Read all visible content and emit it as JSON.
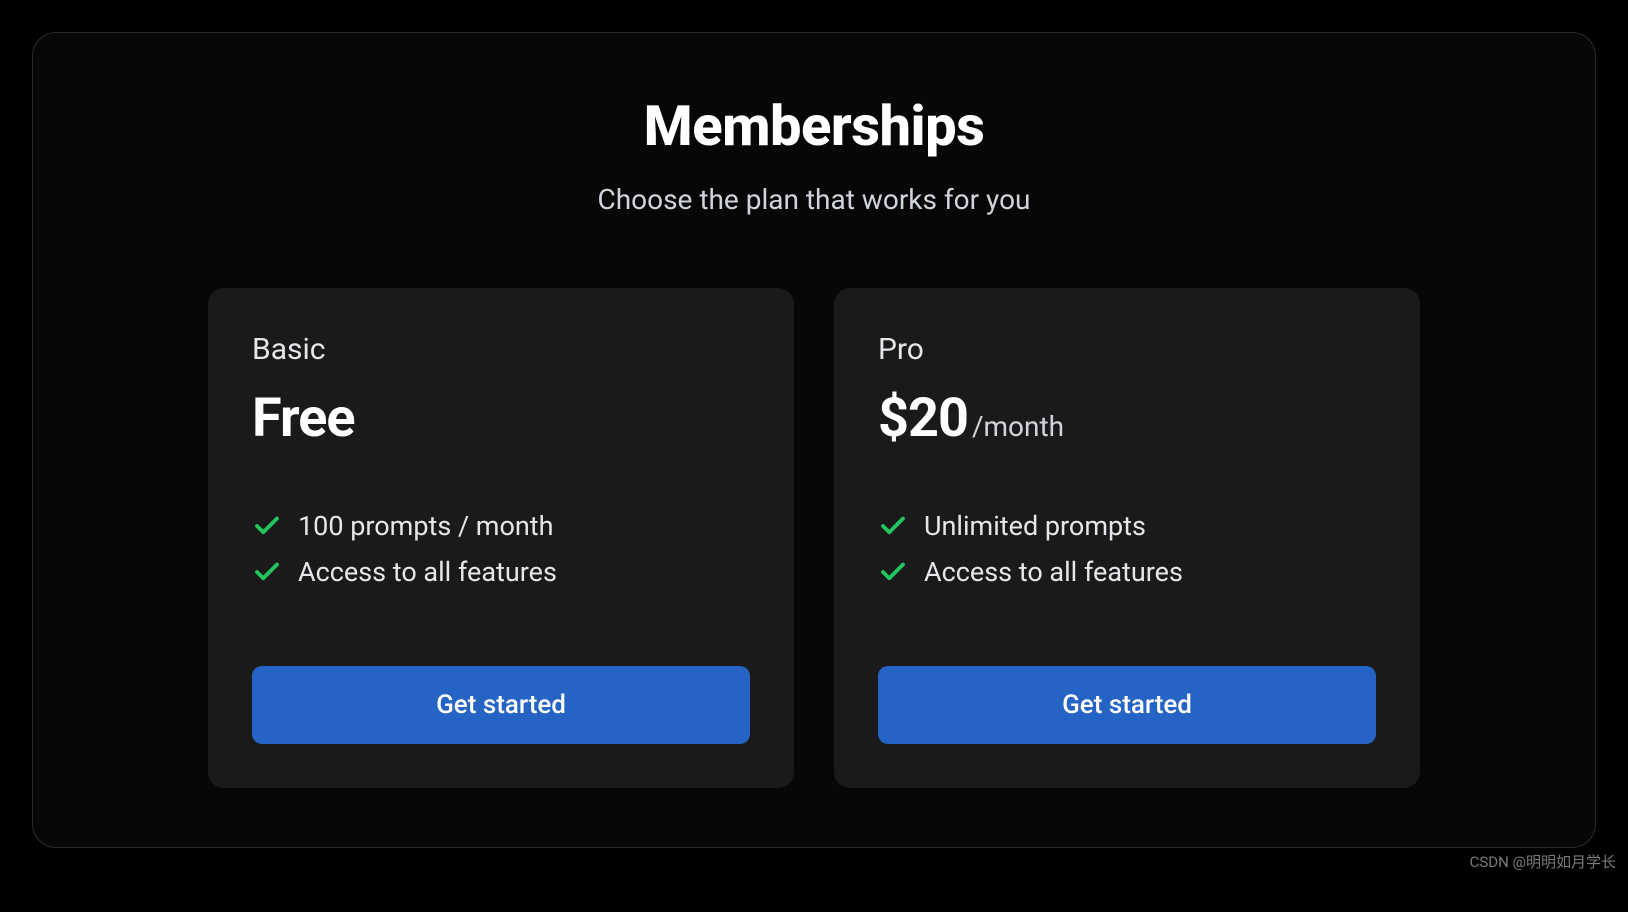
{
  "header": {
    "title": "Memberships",
    "subtitle": "Choose the plan that works for you"
  },
  "plans": [
    {
      "name": "Basic",
      "price": "Free",
      "period": "",
      "features": [
        "100 prompts / month",
        "Access to all features"
      ],
      "cta": "Get started"
    },
    {
      "name": "Pro",
      "price": "$20",
      "period": "/month",
      "features": [
        "Unlimited prompts",
        "Access to all features"
      ],
      "cta": "Get started"
    }
  ],
  "watermark": "CSDN @明明如月学长"
}
